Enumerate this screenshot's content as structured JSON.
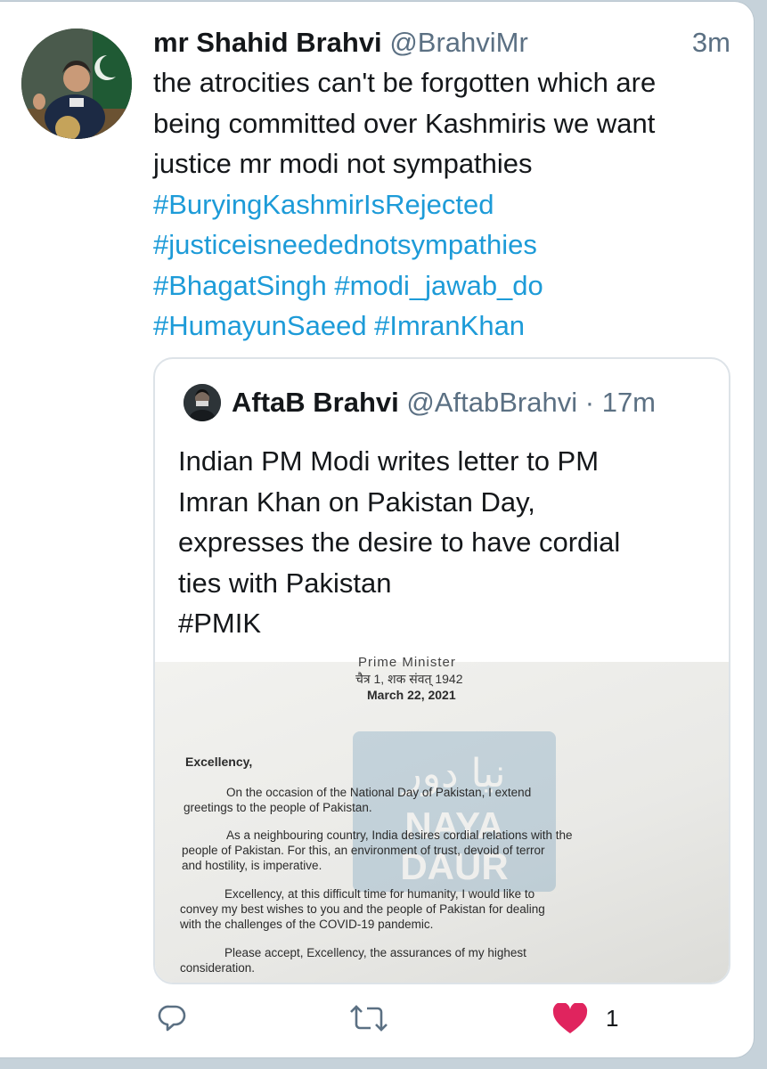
{
  "tweet": {
    "display_name": "mr Shahid Brahvi",
    "handle": "@BrahviMr",
    "time": "3m",
    "text_lines": [
      "the atrocities can't be forgotten which are",
      "being committed over Kashmiris we want",
      "justice mr modi  not sympathies"
    ],
    "hashtag_lines": [
      "#BuryingKashmirIsRejected",
      "#justiceisneedednotsympathies",
      "#BhagatSingh #modi_jawab_do",
      "#HumayunSaeed #ImranKhan"
    ]
  },
  "quoted": {
    "display_name": "AftaB Brahvi",
    "handle": "@AftabBrahvi",
    "separator": "·",
    "time": "17m",
    "text_lines": [
      "Indian PM Modi writes letter to PM",
      "Imran Khan on Pakistan Day,",
      "expresses the desire to have cordial",
      "ties with Pakistan",
      "#PMIK"
    ],
    "letter": {
      "pm_line": "Prime Minister",
      "hindi_date": "चैत्र 1, शक संवत् 1942",
      "date": "March 22, 2021",
      "salutation": "Excellency,",
      "para1_l1": "On the occasion of the National Day of Pakistan, I extend",
      "para1_l2": "greetings to the people of Pakistan.",
      "para2_l1": "As a neighbouring country, India desires cordial relations with the",
      "para2_l2": "people of Pakistan. For this, an environment of trust, devoid of terror",
      "para2_l3": "and hostility, is imperative.",
      "para3_l1": "Excellency, at this difficult time for humanity, I would like to",
      "para3_l2": "convey my best wishes to you and the people of Pakistan for dealing",
      "para3_l3": "with the challenges of the COVID-19 pandemic.",
      "para4_l1": "Please accept, Excellency, the assurances of my highest",
      "para4_l2": "consideration.",
      "watermark_urdu": "نیا دور",
      "watermark_l1": "NAYA",
      "watermark_l2": "DAUR"
    }
  },
  "actions": {
    "reply_icon": "reply-icon",
    "retweet_icon": "retweet-icon",
    "like_icon": "heart-icon",
    "like_count": "1"
  },
  "colors": {
    "hashtag": "#1d9bd8",
    "secondary": "#5b7083",
    "like": "#e0245e",
    "background": "#c6d2da"
  }
}
